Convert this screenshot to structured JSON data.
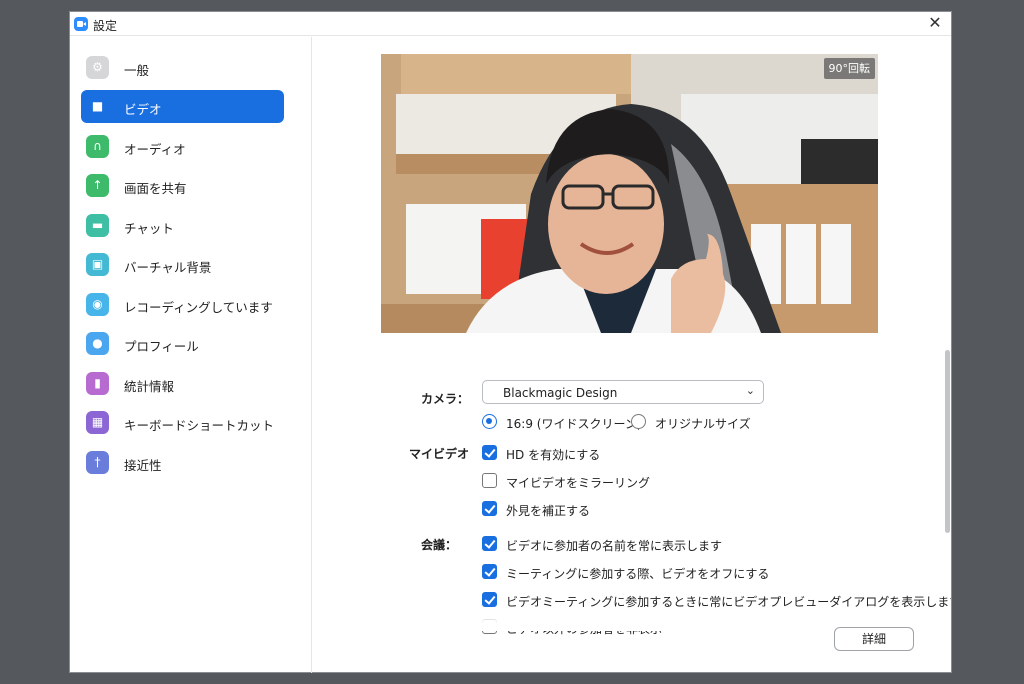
{
  "window": {
    "title": "設定",
    "close": "✕"
  },
  "sidebar": {
    "items": [
      {
        "label": "一般",
        "icon": "gear-icon",
        "color": "#d5d6d8",
        "glyph": "⚙"
      },
      {
        "label": "ビデオ",
        "icon": "video-camera-icon",
        "color": "#1a6fe0",
        "glyph": "■"
      },
      {
        "label": "オーディオ",
        "icon": "headphones-icon",
        "color": "#3dbb6b",
        "glyph": "∩"
      },
      {
        "label": "画面を共有",
        "icon": "share-screen-icon",
        "color": "#3dbb6b",
        "glyph": "↑"
      },
      {
        "label": "チャット",
        "icon": "chat-bubble-icon",
        "color": "#3ebfa4",
        "glyph": "▬"
      },
      {
        "label": "バーチャル背景",
        "icon": "virtual-background-icon",
        "color": "#43b9d4",
        "glyph": "▣"
      },
      {
        "label": "レコーディングしています",
        "icon": "record-icon",
        "color": "#47b4ea",
        "glyph": "◉"
      },
      {
        "label": "プロフィール",
        "icon": "profile-icon",
        "color": "#4aa6ee",
        "glyph": "●"
      },
      {
        "label": "統計情報",
        "icon": "statistics-icon",
        "color": "#b76bd1",
        "glyph": "▮"
      },
      {
        "label": "キーボードショートカット",
        "icon": "keyboard-icon",
        "color": "#8b66d4",
        "glyph": "▦"
      },
      {
        "label": "接近性",
        "icon": "accessibility-icon",
        "color": "#6a7ddb",
        "glyph": "†"
      }
    ]
  },
  "video": {
    "rotate_label": "90°回転",
    "camera_label": "カメラ：",
    "camera_value": "Blackmagic Design",
    "ratio_169": "16:9 (ワイドスクリーン)",
    "ratio_original": "オリジナルサイズ",
    "my_video_label": "マイビデオ",
    "hd_label": "HD を有効にする",
    "mirror_label": "マイビデオをミラーリング",
    "touchup_label": "外見を補正する",
    "meeting_label": "会議：",
    "show_names_label": "ビデオに参加者の名前を常に表示します",
    "video_off_label": "ミーティングに参加する際、ビデオをオフにする",
    "preview_dialog_label": "ビデオミーティングに参加するときに常にビデオプレビューダイアログを表示します",
    "hide_nonvideo_label": "ビデオ以外の参加者を非表示",
    "detail_button": "詳細"
  }
}
